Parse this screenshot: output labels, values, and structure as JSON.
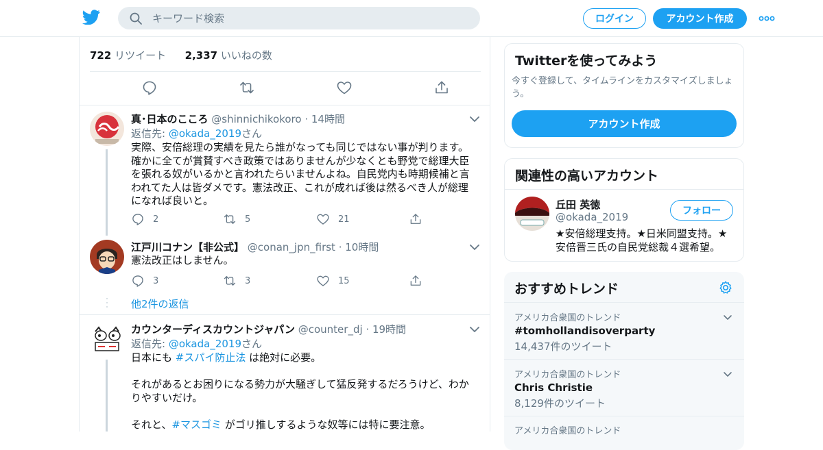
{
  "header": {
    "search_placeholder": "キーワード検索",
    "login_label": "ログイン",
    "signup_label": "アカウント作成"
  },
  "stats": {
    "retweets_count": "722",
    "retweets_label": "リツイート",
    "likes_count": "2,337",
    "likes_label": "いいねの数"
  },
  "tweets": [
    {
      "name": "真･日本のこころ",
      "handle": "@shinnichikokoro",
      "time": "14時間",
      "reply_prefix": "返信先: ",
      "reply_handle": "@okada_2019",
      "reply_suffix": "さん",
      "lines": [
        "実際、安倍総理の実績を見たら誰がなっても同じではない事が判ります。",
        "確かに全てが賞賛すべき政策ではありませんが少なくとも野党で総理大臣",
        "を張れる奴がいるかと言われたらいませんよね。自民党内も時期候補と言",
        "われてた人は皆ダメです。憲法改正、これが成れば後は然るべき人が総理",
        "になれば良いと。"
      ],
      "replies": "2",
      "retweets": "5",
      "likes": "21"
    },
    {
      "name": "江戸川コナン【非公式】",
      "handle": "@conan_jpn_first",
      "time": "10時間",
      "lines": [
        "憲法改正はしません。"
      ],
      "replies": "3",
      "retweets": "3",
      "likes": "15",
      "more_replies": "他2件の返信"
    },
    {
      "name": "カウンターディスカウントジャパン",
      "handle": "@counter_dj",
      "time": "19時間",
      "reply_prefix": "返信先: ",
      "reply_handle": "@okada_2019",
      "reply_suffix": "さん",
      "line1_prefix": "日本にも ",
      "line1_tag": "#スパイ防止法",
      "line1_suffix": " は絶対に必要。",
      "line2": "それがあるとお困りになる勢力が大騒ぎして猛反発するだろうけど、わか",
      "line3": "りやすいだけ。",
      "line4_prefix": "それと、",
      "line4_tag": "#マスゴミ",
      "line4_suffix": " がゴリ推しするような奴等には特に要注意。"
    }
  ],
  "sidebar": {
    "signup_card": {
      "title": "Twitterを使ってみよう",
      "description": "今すぐ登録して、タイムラインをカスタマイズしましょう。",
      "button": "アカウント作成"
    },
    "related": {
      "title": "関連性の高いアカウント",
      "name": "丘田 英徳",
      "handle": "@okada_2019",
      "follow_label": "フォロー",
      "bio": "★安倍総理支持。★日米同盟支持。★安倍晋三氏の自民党総裁４選希望。"
    },
    "trends": {
      "title": "おすすめトレンド",
      "items": [
        {
          "location": "アメリカ合衆国のトレンド",
          "topic": "#tomhollandisoverparty",
          "count": "14,437件のツイート"
        },
        {
          "location": "アメリカ合衆国のトレンド",
          "topic": "Chris Christie",
          "count": "8,129件のツイート"
        },
        {
          "location": "アメリカ合衆国のトレンド",
          "topic": "",
          "count": ""
        }
      ]
    }
  },
  "colors": {
    "brand": "#1da1f2",
    "link": "#1b95e0",
    "muted": "#657786",
    "border": "#e6ecf0"
  },
  "icons": [
    "twitter-logo-icon",
    "search-icon",
    "more-icon",
    "reply-icon",
    "retweet-icon",
    "like-icon",
    "share-icon",
    "chevron-down-icon",
    "gear-icon"
  ]
}
